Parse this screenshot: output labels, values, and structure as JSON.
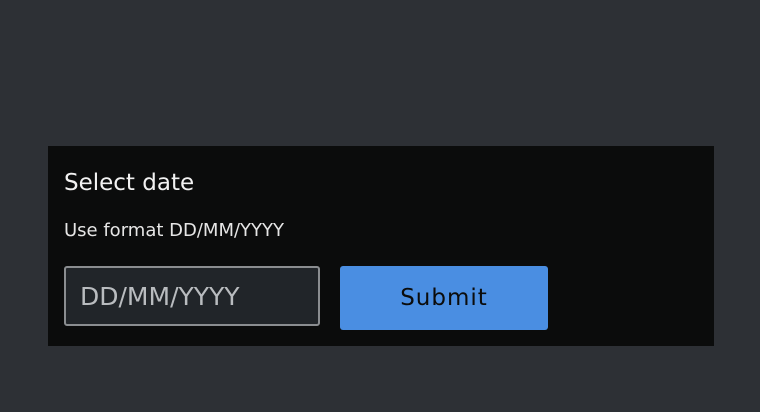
{
  "form": {
    "title": "Select date",
    "hint": "Use format DD/MM/YYYY",
    "date_input": {
      "value": "",
      "placeholder": "DD/MM/YYYY"
    },
    "submit_label": "Submit"
  },
  "colors": {
    "background": "#2d3035",
    "panel": "#0b0c0c",
    "accent": "#4a8ee2"
  }
}
